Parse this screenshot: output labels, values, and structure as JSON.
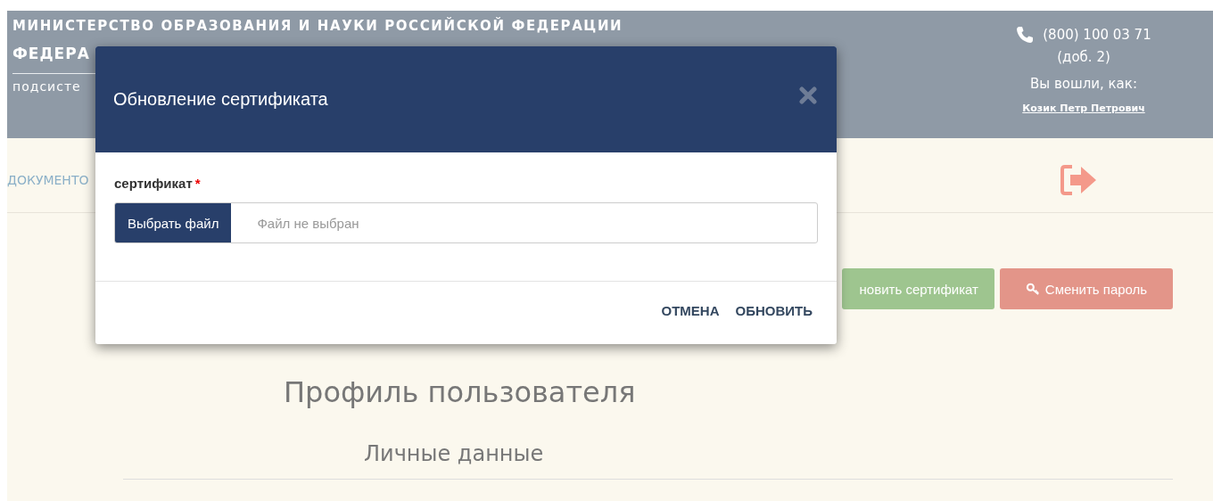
{
  "header": {
    "ministry": "МИНИСТЕРСТВО ОБРАЗОВАНИЯ И НАУКИ РОССИЙСКОЙ ФЕДЕРАЦИИ",
    "service": "ФЕДЕРА",
    "subsystem": "подсисте",
    "phone": "(800) 100 03 71",
    "extension": "(доб. 2)",
    "logged_in_label": "Вы вошли, как:",
    "user": "Козик Петр Петрович"
  },
  "nav": {
    "item": "ДОКУМЕНТО"
  },
  "actions": [
    {
      "label": "новить сертификат",
      "kind": "certificate"
    },
    {
      "label": "Сменить пароль",
      "kind": "password"
    }
  ],
  "page": {
    "title": "Профиль пользователя",
    "section": "Личные данные"
  },
  "dialog": {
    "title": "Обновление сертификата",
    "field_label": "сертификат",
    "required_mark": "*",
    "choose_button": "Выбрать файл",
    "file_status": "Файл не выбран",
    "buttons": [
      "ОТМЕНА",
      "ОБНОВИТЬ"
    ]
  }
}
